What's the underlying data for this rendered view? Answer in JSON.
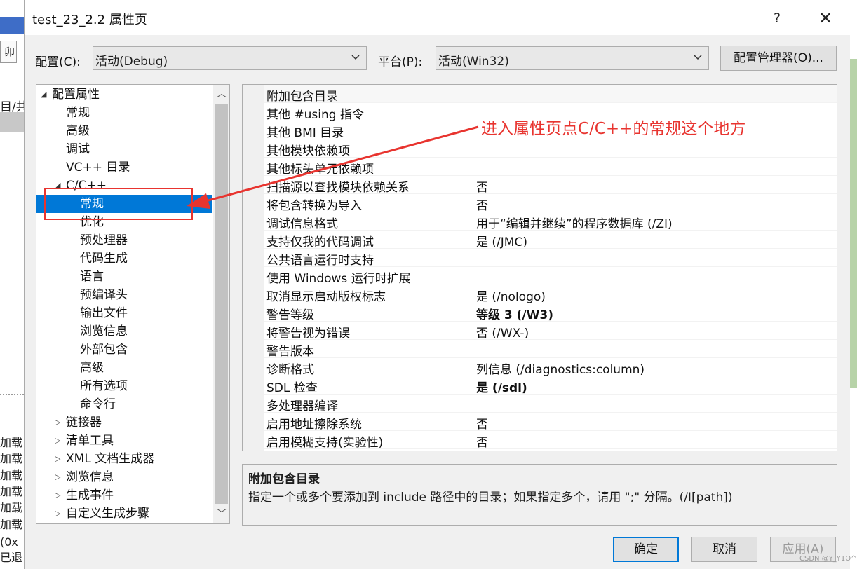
{
  "background": {
    "left_box_text": "卯",
    "left_text": "目/共",
    "log_lines": [
      "加载",
      "加载",
      "加载",
      "加载",
      "加载",
      "加载",
      "(0x",
      "已退"
    ]
  },
  "dialog": {
    "title": "test_23_2.2 属性页",
    "help_label": "?",
    "close_label": "✕"
  },
  "config": {
    "config_label": "配置(C):",
    "config_value": "活动(Debug)",
    "platform_label": "平台(P):",
    "platform_value": "活动(Win32)",
    "manager_button": "配置管理器(O)..."
  },
  "tree": {
    "items": [
      {
        "label": "配置属性",
        "expander": "◢",
        "level": 0
      },
      {
        "label": "常规",
        "expander": "",
        "level": 1
      },
      {
        "label": "高级",
        "expander": "",
        "level": 1
      },
      {
        "label": "调试",
        "expander": "",
        "level": 1
      },
      {
        "label": "VC++ 目录",
        "expander": "",
        "level": 1
      },
      {
        "label": "C/C++",
        "expander": "◢",
        "level": 1
      },
      {
        "label": "常规",
        "expander": "",
        "level": 2,
        "selected": true
      },
      {
        "label": "优化",
        "expander": "",
        "level": 2
      },
      {
        "label": "预处理器",
        "expander": "",
        "level": 2
      },
      {
        "label": "代码生成",
        "expander": "",
        "level": 2
      },
      {
        "label": "语言",
        "expander": "",
        "level": 2
      },
      {
        "label": "预编译头",
        "expander": "",
        "level": 2
      },
      {
        "label": "输出文件",
        "expander": "",
        "level": 2
      },
      {
        "label": "浏览信息",
        "expander": "",
        "level": 2
      },
      {
        "label": "外部包含",
        "expander": "",
        "level": 2
      },
      {
        "label": "高级",
        "expander": "",
        "level": 2
      },
      {
        "label": "所有选项",
        "expander": "",
        "level": 2
      },
      {
        "label": "命令行",
        "expander": "",
        "level": 2
      },
      {
        "label": "链接器",
        "expander": "▷",
        "level": 1
      },
      {
        "label": "清单工具",
        "expander": "▷",
        "level": 1
      },
      {
        "label": "XML 文档生成器",
        "expander": "▷",
        "level": 1
      },
      {
        "label": "浏览信息",
        "expander": "▷",
        "level": 1
      },
      {
        "label": "生成事件",
        "expander": "▷",
        "level": 1
      },
      {
        "label": "自定义生成步骤",
        "expander": "▷",
        "level": 1
      }
    ]
  },
  "properties": [
    {
      "name": "附加包含目录",
      "value": "",
      "bold": false
    },
    {
      "name": "其他 #using 指令",
      "value": "",
      "bold": false
    },
    {
      "name": "其他 BMI 目录",
      "value": "",
      "bold": false
    },
    {
      "name": "其他模块依赖项",
      "value": "",
      "bold": false
    },
    {
      "name": "其他标头单元依赖项",
      "value": "",
      "bold": false
    },
    {
      "name": "扫描源以查找模块依赖关系",
      "value": "否",
      "bold": false
    },
    {
      "name": "将包含转换为导入",
      "value": "否",
      "bold": false
    },
    {
      "name": "调试信息格式",
      "value": "用于“编辑并继续”的程序数据库 (/ZI)",
      "bold": false
    },
    {
      "name": "支持仅我的代码调试",
      "value": "是 (/JMC)",
      "bold": false
    },
    {
      "name": "公共语言运行时支持",
      "value": "",
      "bold": false
    },
    {
      "name": "使用 Windows 运行时扩展",
      "value": "",
      "bold": false
    },
    {
      "name": "取消显示启动版权标志",
      "value": "是 (/nologo)",
      "bold": false
    },
    {
      "name": "警告等级",
      "value": "等级 3 (/W3)",
      "bold": true
    },
    {
      "name": "将警告视为错误",
      "value": "否 (/WX-)",
      "bold": false
    },
    {
      "name": "警告版本",
      "value": "",
      "bold": false
    },
    {
      "name": "诊断格式",
      "value": "列信息 (/diagnostics:column)",
      "bold": false
    },
    {
      "name": "SDL 检查",
      "value": "是 (/sdl)",
      "bold": true
    },
    {
      "name": "多处理器编译",
      "value": "",
      "bold": false
    },
    {
      "name": "启用地址擦除系统",
      "value": "否",
      "bold": false
    },
    {
      "name": "启用模糊支持(实验性)",
      "value": "否",
      "bold": false
    }
  ],
  "description": {
    "title": "附加包含目录",
    "text": "指定一个或多个要添加到 include 路径中的目录；如果指定多个，请用 \";\" 分隔。(/I[path])"
  },
  "buttons": {
    "ok": "确定",
    "cancel": "取消",
    "apply": "应用(A)"
  },
  "annotation": {
    "text": "进入属性页点C/C++的常规这个地方",
    "color": "#e8342f"
  },
  "watermark": "CSDN @Y_Y1O^"
}
